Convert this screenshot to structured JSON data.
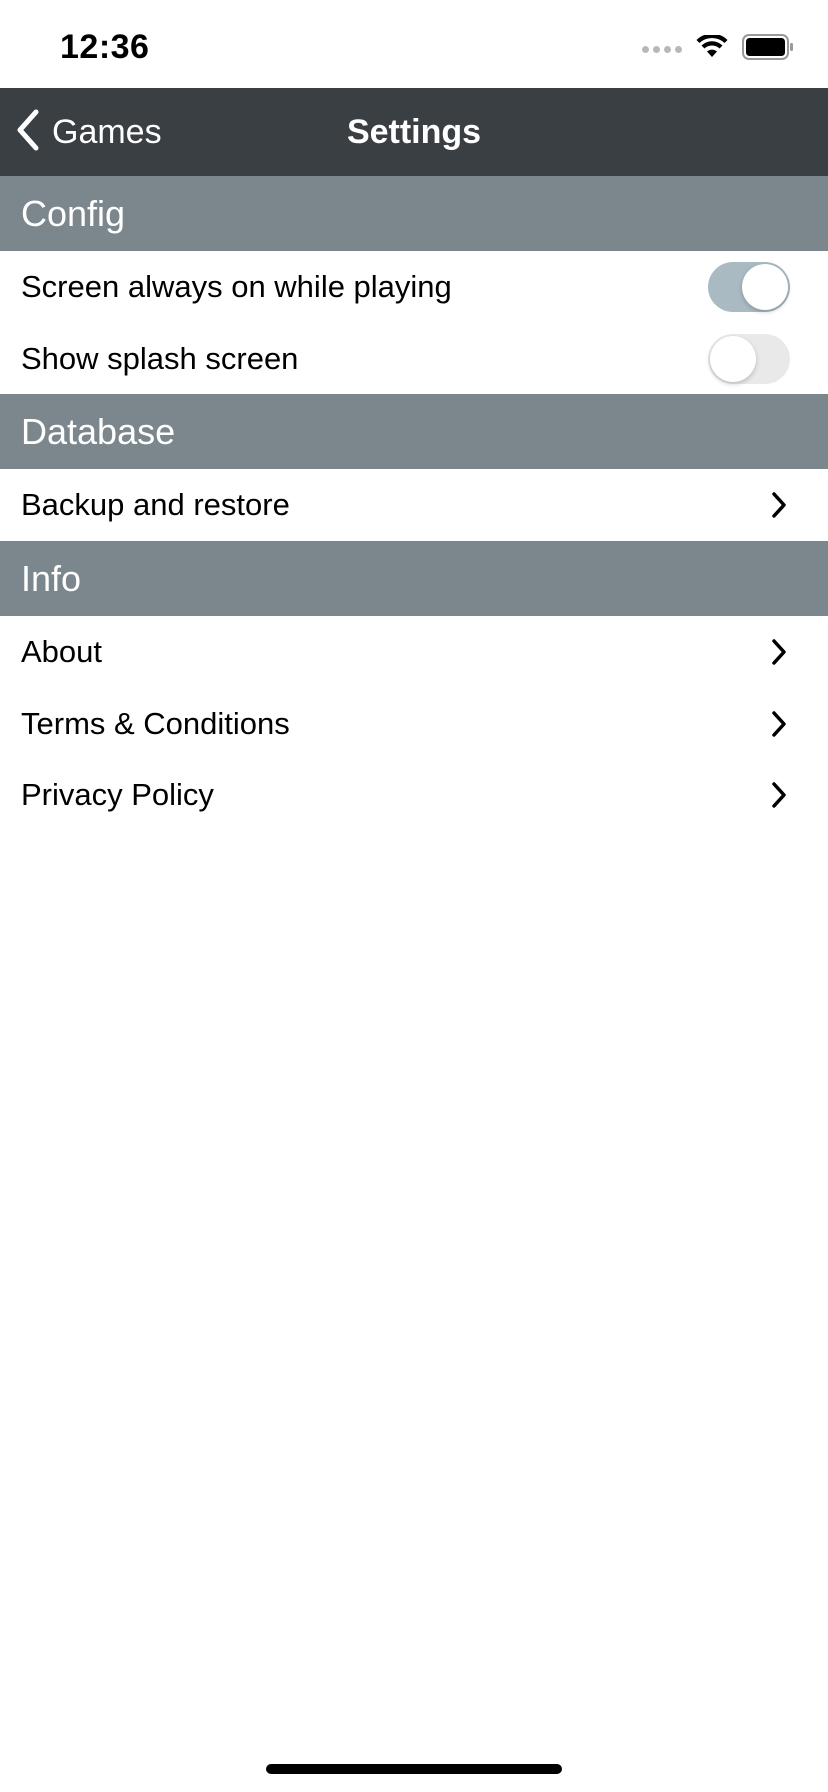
{
  "status_bar": {
    "time": "12:36",
    "icons": [
      "signal-icon",
      "wifi-icon",
      "battery-icon"
    ]
  },
  "nav": {
    "back_label": "Games",
    "back_icon": "chevron-left-icon",
    "title": "Settings"
  },
  "sections": {
    "config": {
      "header": "Config",
      "items": [
        {
          "label": "Screen always on while playing",
          "control": "toggle",
          "on": true
        },
        {
          "label": "Show splash screen",
          "control": "toggle",
          "on": false
        }
      ]
    },
    "database": {
      "header": "Database",
      "items": [
        {
          "label": "Backup and restore",
          "control": "chevron-right-icon"
        }
      ]
    },
    "info": {
      "header": "Info",
      "items": [
        {
          "label": "About",
          "control": "chevron-right-icon"
        },
        {
          "label": "Terms & Conditions",
          "control": "chevron-right-icon"
        },
        {
          "label": "Privacy Policy",
          "control": "chevron-right-icon"
        }
      ]
    }
  },
  "colors": {
    "nav_background": "#3a3f43",
    "section_header_background": "#7b878d",
    "toggle_on": "#aabac2",
    "toggle_off": "#e9e9ea"
  }
}
